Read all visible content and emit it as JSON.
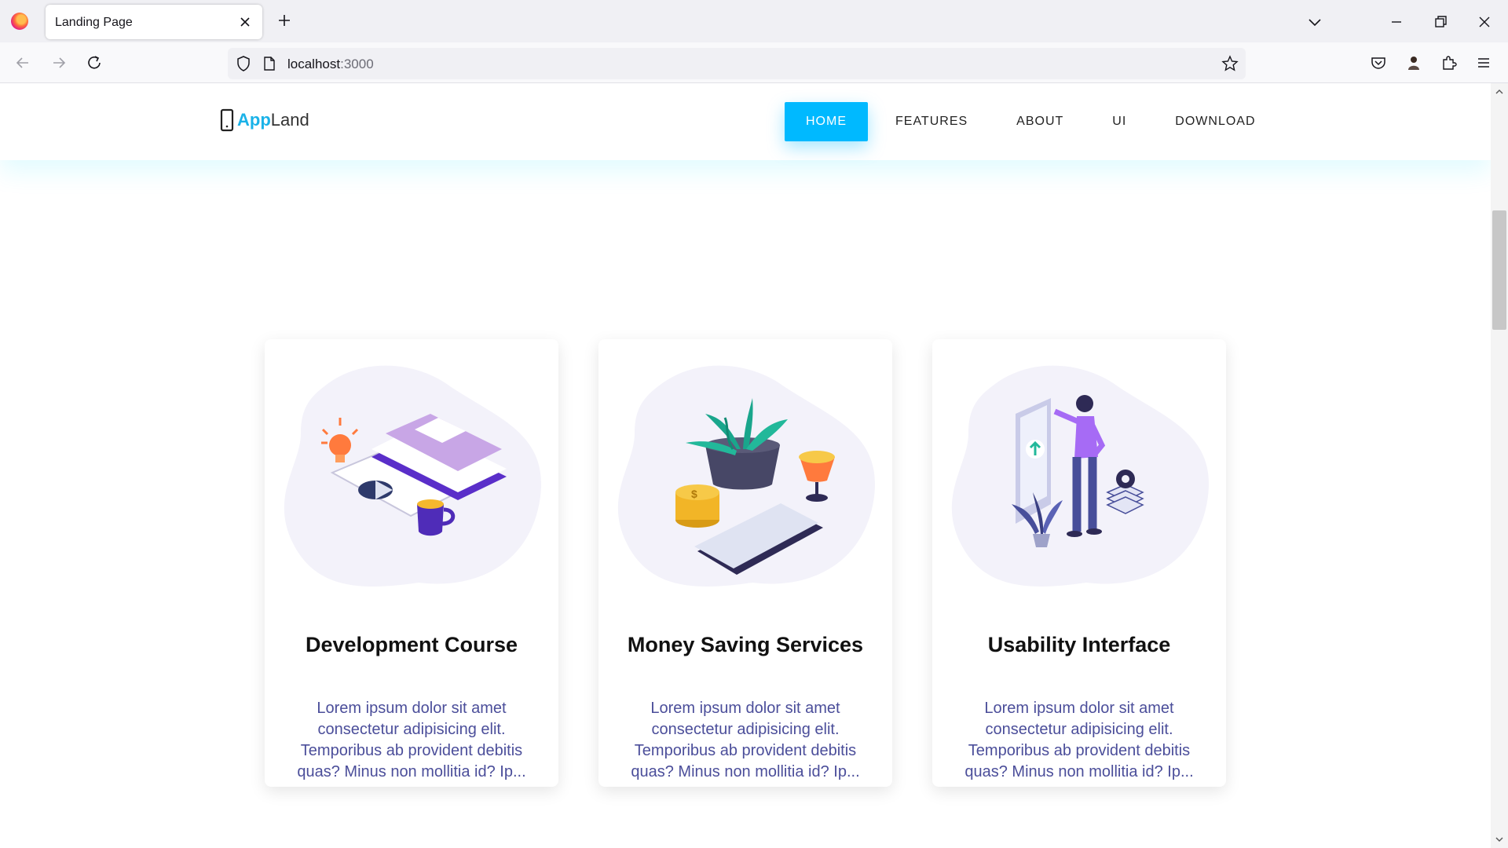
{
  "browser": {
    "tab_title": "Landing Page",
    "url_host": "localhost",
    "url_port": ":3000"
  },
  "site": {
    "brand": {
      "app": "App",
      "land": "Land",
      "accent": "#1ab2e8"
    },
    "menu": [
      {
        "label": "HOME",
        "active": true
      },
      {
        "label": "FEATURES",
        "active": false
      },
      {
        "label": "ABOUT",
        "active": false
      },
      {
        "label": "UI",
        "active": false
      },
      {
        "label": "DOWNLOAD",
        "active": false
      }
    ],
    "menu_accent": "#00b9ff"
  },
  "cards": [
    {
      "title": "Development Course",
      "text": "Lorem ipsum dolor sit amet consectetur adipisicing elit. Temporibus ab provident debitis quas? Minus non mollitia id? Ip...",
      "art": "books-and-coffee-illustration"
    },
    {
      "title": "Money Saving Services",
      "text": "Lorem ipsum dolor sit amet consectetur adipisicing elit. Temporibus ab provident debitis quas? Minus non mollitia id? Ip...",
      "art": "plant-coins-tablet-illustration"
    },
    {
      "title": "Usability Interface",
      "text": "Lorem ipsum dolor sit amet consectetur adipisicing elit. Temporibus ab provident debitis quas? Minus non mollitia id? Ip...",
      "art": "person-with-phone-illustration"
    }
  ]
}
